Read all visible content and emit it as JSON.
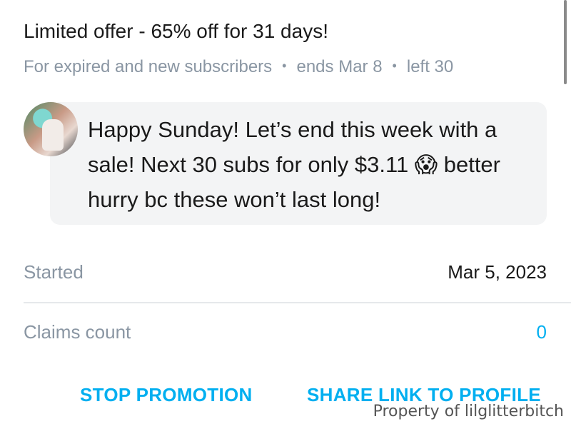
{
  "offer": {
    "title": "Limited offer - 65% off for 31 days!",
    "audience": "For expired and new subscribers",
    "ends": "ends Mar 8",
    "left": "left 30",
    "separator": "•"
  },
  "message": {
    "text": "Happy Sunday! Let’s end this week with a sale! Next 30 subs for only $3.11 😱 bet­ter hurry bc these won’t last long!"
  },
  "details": {
    "started_label": "Started",
    "started_value": "Mar 5, 2023",
    "claims_label": "Claims count",
    "claims_value": "0"
  },
  "actions": {
    "stop_label": "STOP PROMOTION",
    "share_label": "SHARE LINK TO PROFILE"
  },
  "watermark": "Property of lilglitterbitch",
  "colors": {
    "accent": "#00aff0",
    "muted": "#8a96a3",
    "bubble_bg": "#f3f4f5"
  }
}
